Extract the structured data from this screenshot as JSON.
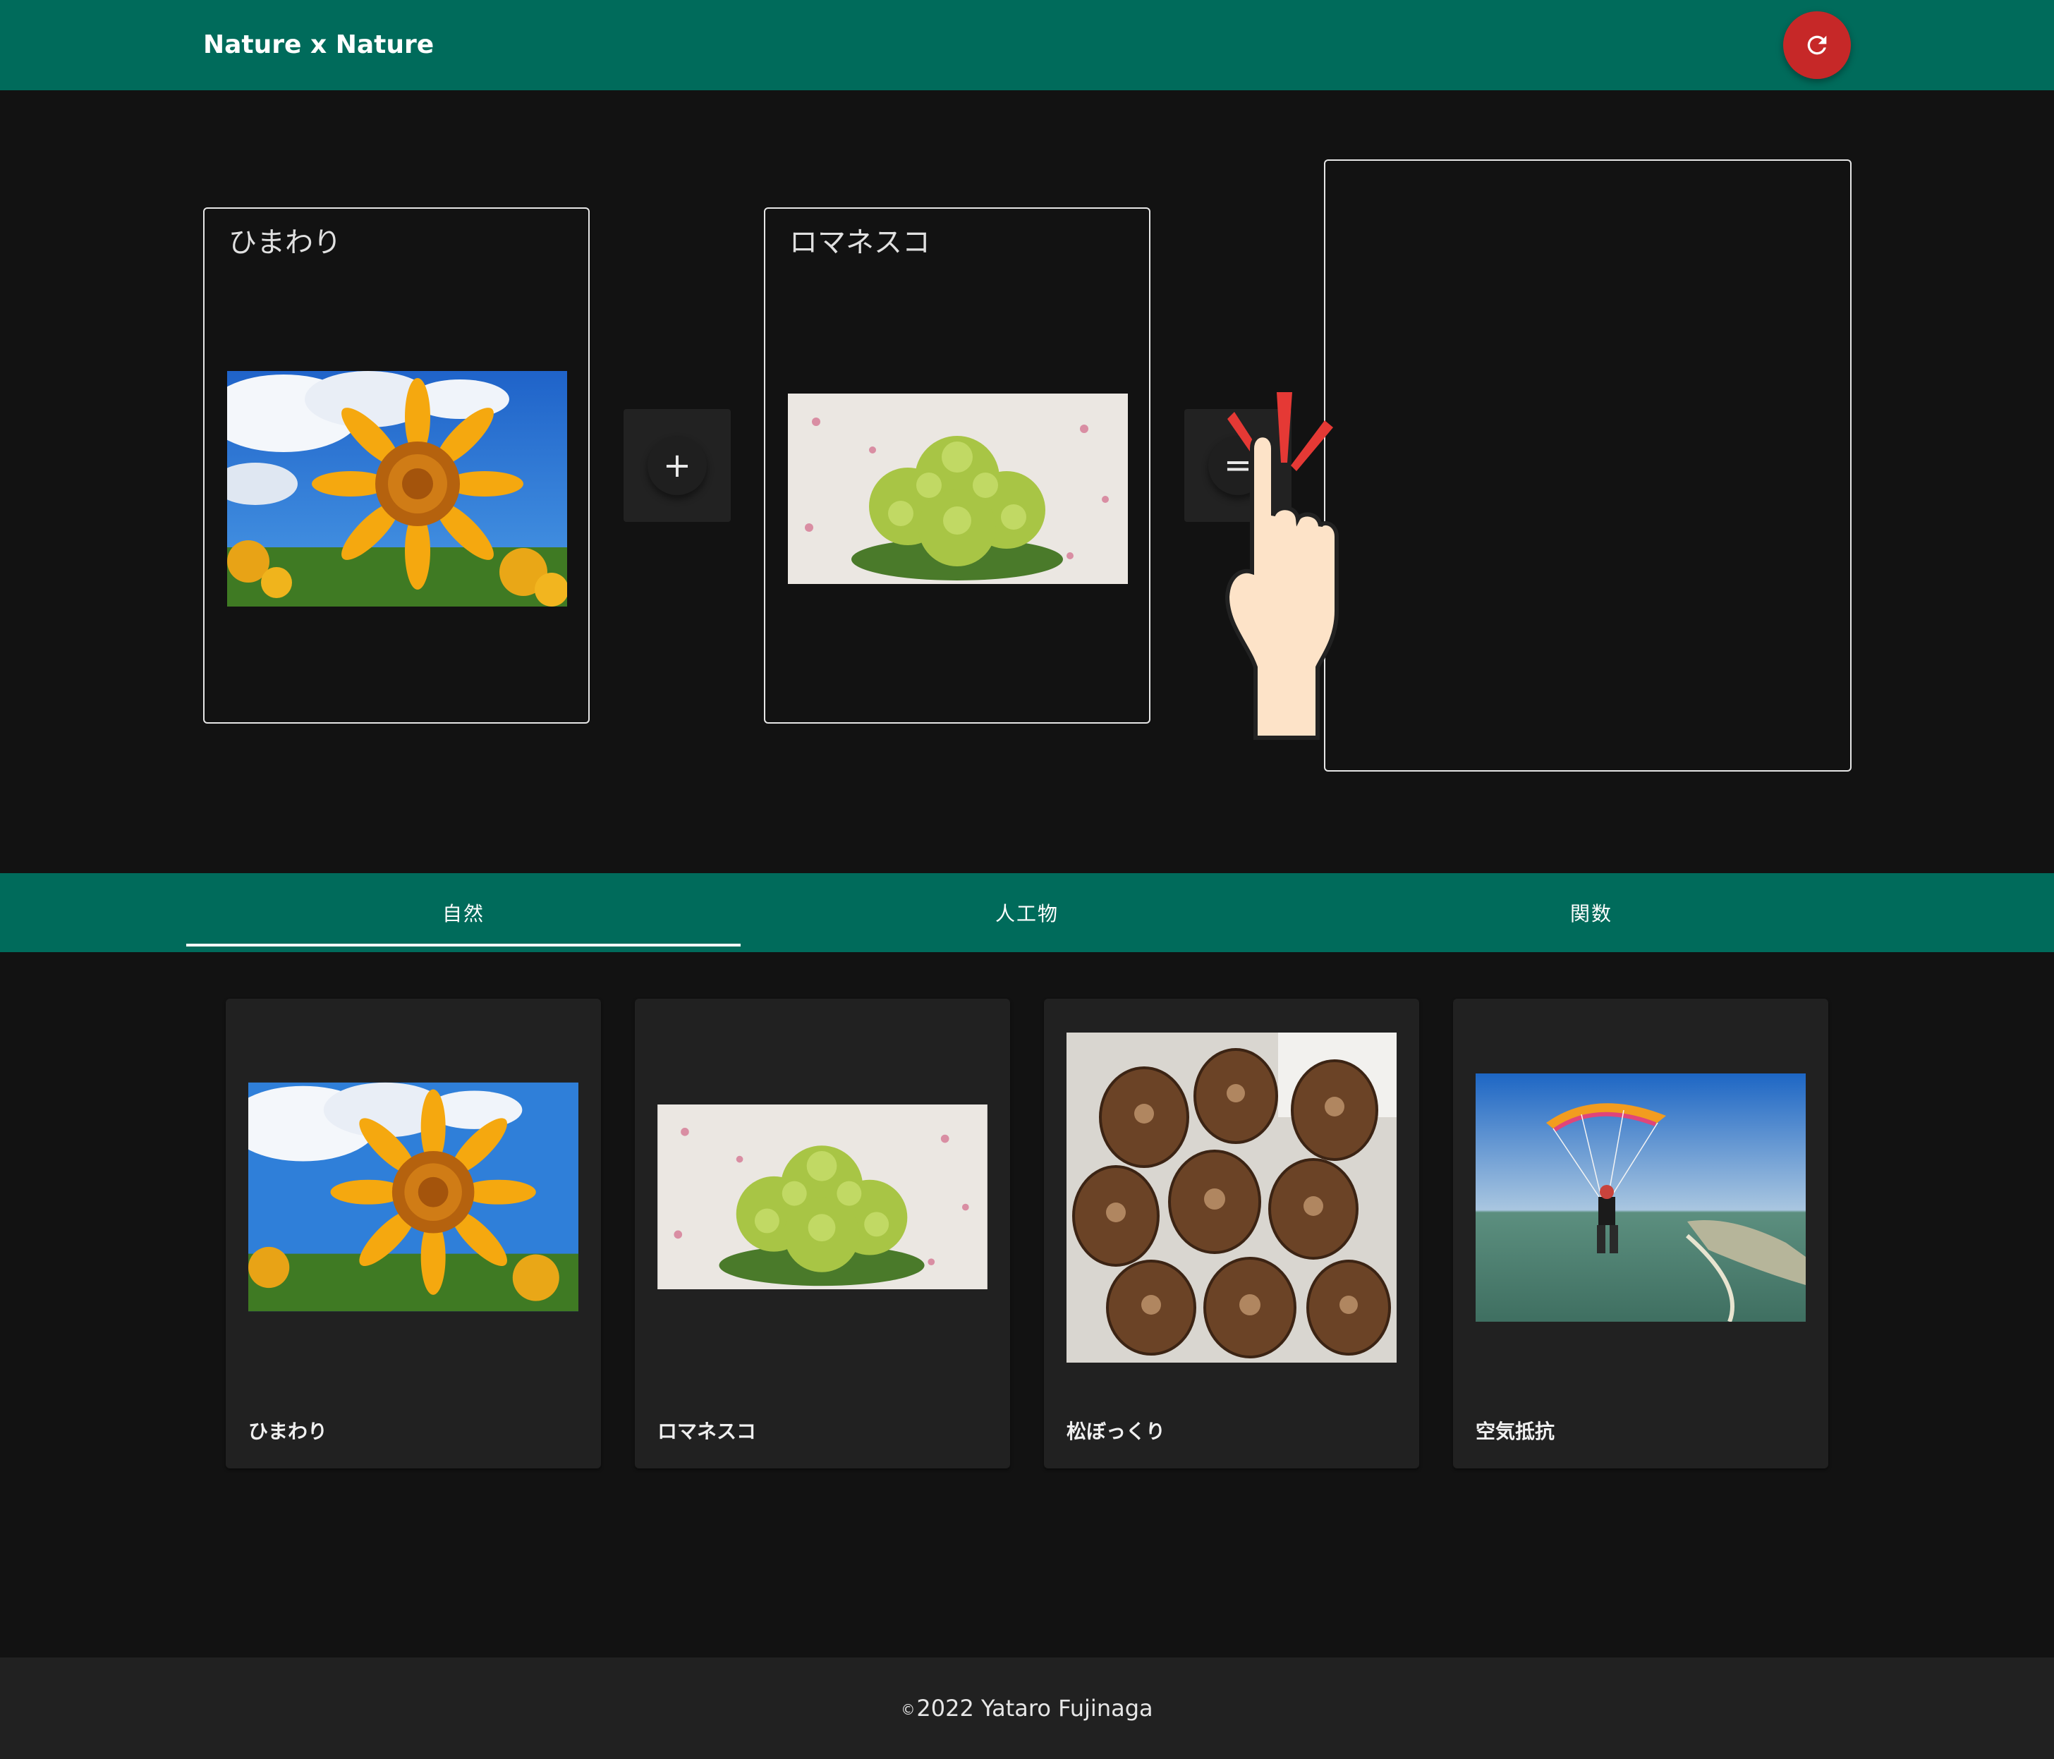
{
  "header": {
    "title": "Nature x Nature",
    "refresh_icon": "refresh-icon"
  },
  "combine": {
    "left": {
      "title": "ひまわり"
    },
    "operator_plus": "+",
    "right": {
      "title": "ロマネスコ"
    },
    "operator_equals": "="
  },
  "tabs": [
    {
      "label": "自然",
      "active": true
    },
    {
      "label": "人工物",
      "active": false
    },
    {
      "label": "関数",
      "active": false
    }
  ],
  "cards": [
    {
      "label": "ひまわり"
    },
    {
      "label": "ロマネスコ"
    },
    {
      "label": "松ぼっくり"
    },
    {
      "label": "空気抵抗"
    }
  ],
  "footer": {
    "copyright_symbol": "©",
    "text": "2022 Yataro Fujinaga"
  },
  "colors": {
    "primary": "#006b5b",
    "accent": "#c62828",
    "background": "#121212",
    "surface": "#212121"
  }
}
